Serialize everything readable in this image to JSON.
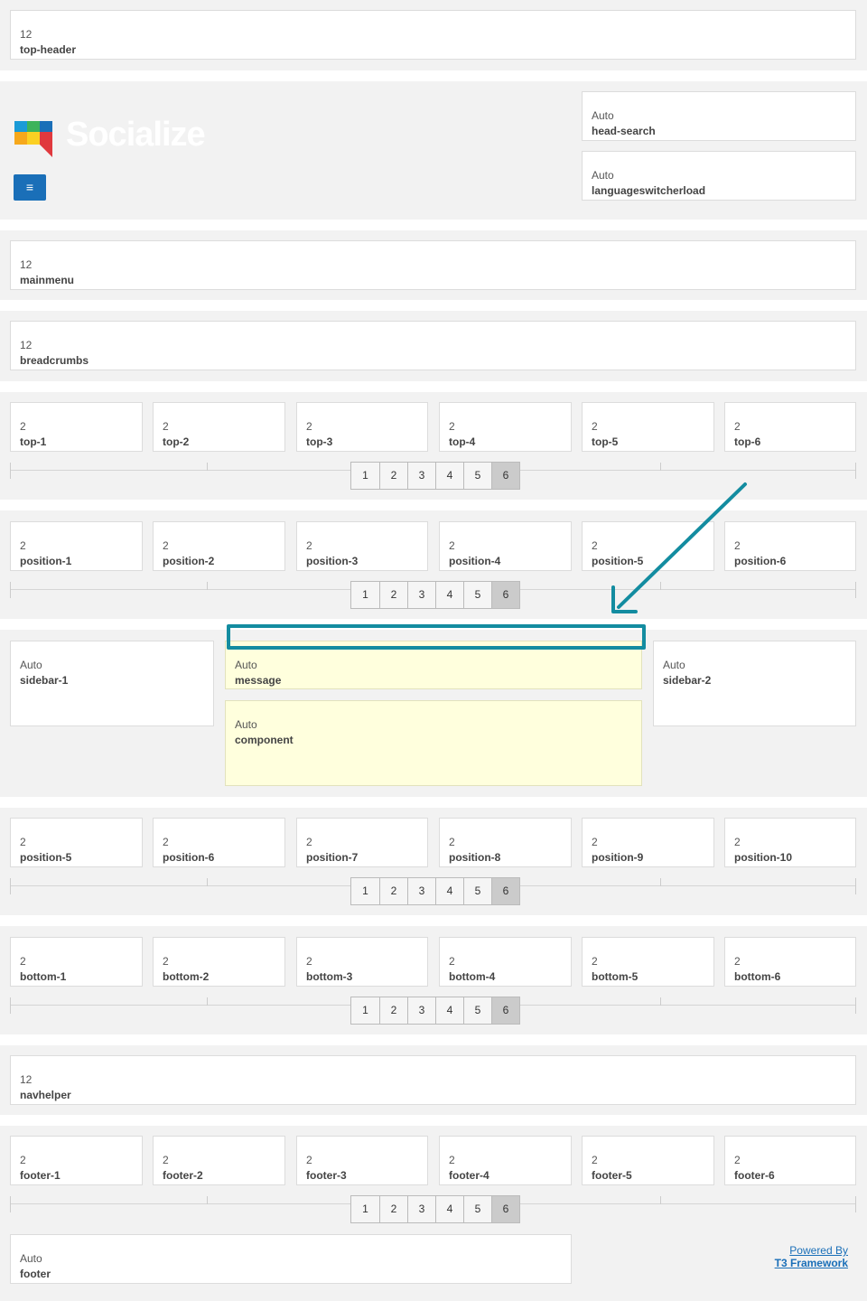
{
  "header": {
    "logo_text": "Socialize",
    "menu_icon": "hamburger-menu-icon"
  },
  "rows": {
    "top_header": {
      "width": "12",
      "name": "top-header"
    },
    "head_search": {
      "width": "Auto",
      "name": "head-search"
    },
    "languageswitcher": {
      "width": "Auto",
      "name": "languageswitcherload"
    },
    "mainmenu": {
      "width": "12",
      "name": "mainmenu"
    },
    "breadcrumbs": {
      "width": "12",
      "name": "breadcrumbs"
    },
    "top": [
      {
        "width": "2",
        "name": "top-1"
      },
      {
        "width": "2",
        "name": "top-2"
      },
      {
        "width": "2",
        "name": "top-3"
      },
      {
        "width": "2",
        "name": "top-4"
      },
      {
        "width": "2",
        "name": "top-5"
      },
      {
        "width": "2",
        "name": "top-6"
      }
    ],
    "position_a": [
      {
        "width": "2",
        "name": "position-1"
      },
      {
        "width": "2",
        "name": "position-2"
      },
      {
        "width": "2",
        "name": "position-3"
      },
      {
        "width": "2",
        "name": "position-4"
      },
      {
        "width": "2",
        "name": "position-5"
      },
      {
        "width": "2",
        "name": "position-6"
      }
    ],
    "sidebar_1": {
      "width": "Auto",
      "name": "sidebar-1"
    },
    "message": {
      "width": "Auto",
      "name": "message"
    },
    "component": {
      "width": "Auto",
      "name": "component"
    },
    "sidebar_2": {
      "width": "Auto",
      "name": "sidebar-2"
    },
    "position_b": [
      {
        "width": "2",
        "name": "position-5"
      },
      {
        "width": "2",
        "name": "position-6"
      },
      {
        "width": "2",
        "name": "position-7"
      },
      {
        "width": "2",
        "name": "position-8"
      },
      {
        "width": "2",
        "name": "position-9"
      },
      {
        "width": "2",
        "name": "position-10"
      }
    ],
    "bottom": [
      {
        "width": "2",
        "name": "bottom-1"
      },
      {
        "width": "2",
        "name": "bottom-2"
      },
      {
        "width": "2",
        "name": "bottom-3"
      },
      {
        "width": "2",
        "name": "bottom-4"
      },
      {
        "width": "2",
        "name": "bottom-5"
      },
      {
        "width": "2",
        "name": "bottom-6"
      }
    ],
    "navhelper": {
      "width": "12",
      "name": "navhelper"
    },
    "footer_row": [
      {
        "width": "2",
        "name": "footer-1"
      },
      {
        "width": "2",
        "name": "footer-2"
      },
      {
        "width": "2",
        "name": "footer-3"
      },
      {
        "width": "2",
        "name": "footer-4"
      },
      {
        "width": "2",
        "name": "footer-5"
      },
      {
        "width": "2",
        "name": "footer-6"
      }
    ],
    "footer": {
      "width": "Auto",
      "name": "footer"
    }
  },
  "pager": {
    "labels": [
      "1",
      "2",
      "3",
      "4",
      "5",
      "6"
    ],
    "active": "6"
  },
  "powered": {
    "line1": "Powered By",
    "line2": "T3 Framework"
  },
  "colors": {
    "band": "#f2f2f2",
    "highlight": "#ffffdd",
    "annotation": "#138ca0",
    "menu_button": "#1a6fb8"
  }
}
